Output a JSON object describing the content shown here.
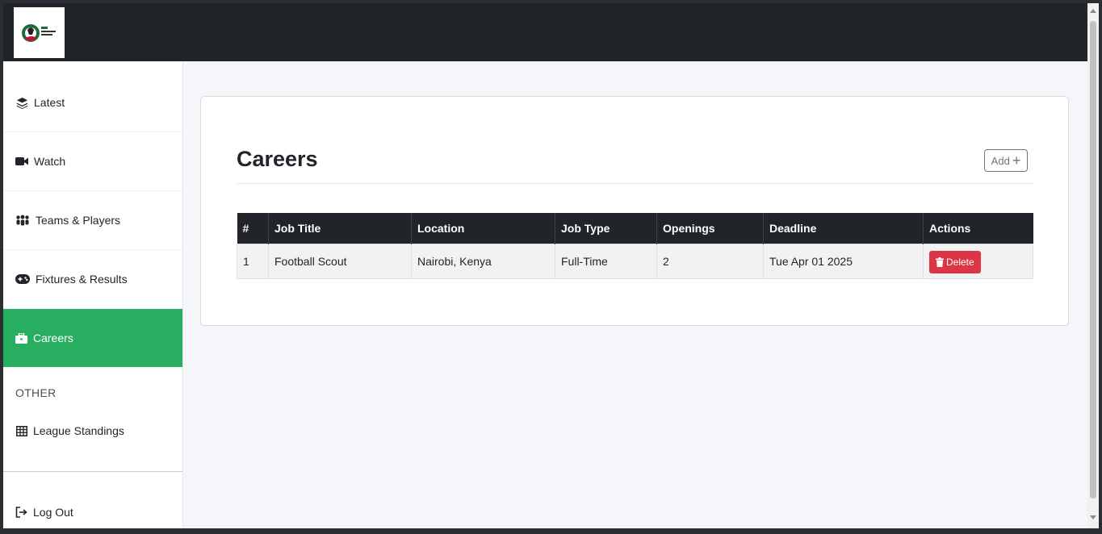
{
  "header": {
    "logo_alt": "FKF Premier League"
  },
  "sidebar": {
    "items": [
      {
        "label": "Latest",
        "icon": "layers-icon"
      },
      {
        "label": "Watch",
        "icon": "video-camera-icon"
      },
      {
        "label": "Teams & Players",
        "icon": "people-icon"
      },
      {
        "label": "Fixtures & Results",
        "icon": "gamepad-icon"
      },
      {
        "label": "Careers",
        "icon": "briefcase-icon",
        "active": true
      }
    ],
    "section_other": "OTHER",
    "other_items": [
      {
        "label": "League Standings",
        "icon": "table-icon"
      }
    ],
    "logout_label": "Log Out"
  },
  "main": {
    "title": "Careers",
    "add_label": "Add",
    "table": {
      "headers": [
        "#",
        "Job Title",
        "Location",
        "Job Type",
        "Openings",
        "Deadline",
        "Actions"
      ],
      "rows": [
        {
          "num": "1",
          "title": "Football Scout",
          "location": "Nairobi, Kenya",
          "type": "Full-Time",
          "openings": "2",
          "deadline": "Tue Apr 01 2025",
          "action": "Delete"
        }
      ]
    }
  },
  "colors": {
    "accent": "#27ae60",
    "danger": "#dc3545",
    "dark": "#212529"
  }
}
